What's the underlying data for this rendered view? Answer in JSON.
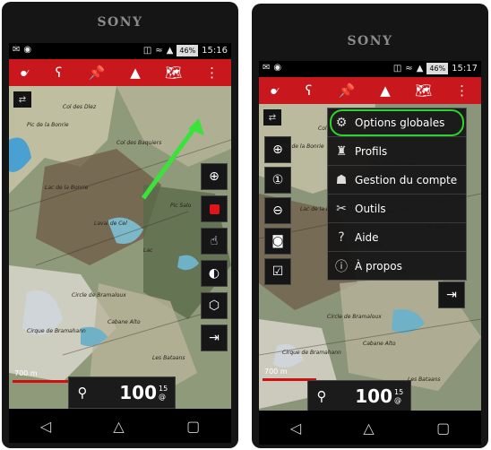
{
  "brand": "SONY",
  "left": {
    "status_time": "15:16",
    "battery": "46%",
    "scale_label": "700 m",
    "zoom_value": "100",
    "zoom_sup_top": "15",
    "zoom_sup_bottom": "@"
  },
  "right": {
    "status_time": "15:17",
    "battery": "46%",
    "scale_label": "700 m",
    "zoom_value": "100",
    "zoom_sup_top": "15",
    "zoom_sup_bottom": "@",
    "menu": [
      {
        "label": "Options globales",
        "icon": "gear-icon"
      },
      {
        "label": "Profils",
        "icon": "profile-icon"
      },
      {
        "label": "Gestion du compte",
        "icon": "account-icon"
      },
      {
        "label": "Outils",
        "icon": "tools-icon"
      },
      {
        "label": "Aide",
        "icon": "help-icon"
      },
      {
        "label": "À propos",
        "icon": "info-icon"
      }
    ]
  },
  "map_place_labels": [
    "Pic de la Bonrie",
    "Col des Dlez",
    "Lac de la Bonrie",
    "Laval de Cel",
    "Circle de Bramaloux",
    "Lac",
    "Cirque de Bramahann",
    "Les Bataans",
    "Col des Baquiers",
    "Pic Salo",
    "Cabane Alto"
  ],
  "colors": {
    "toolbar": "#c8181d",
    "highlight": "#2cd52c",
    "arrow": "#3ce23c"
  }
}
